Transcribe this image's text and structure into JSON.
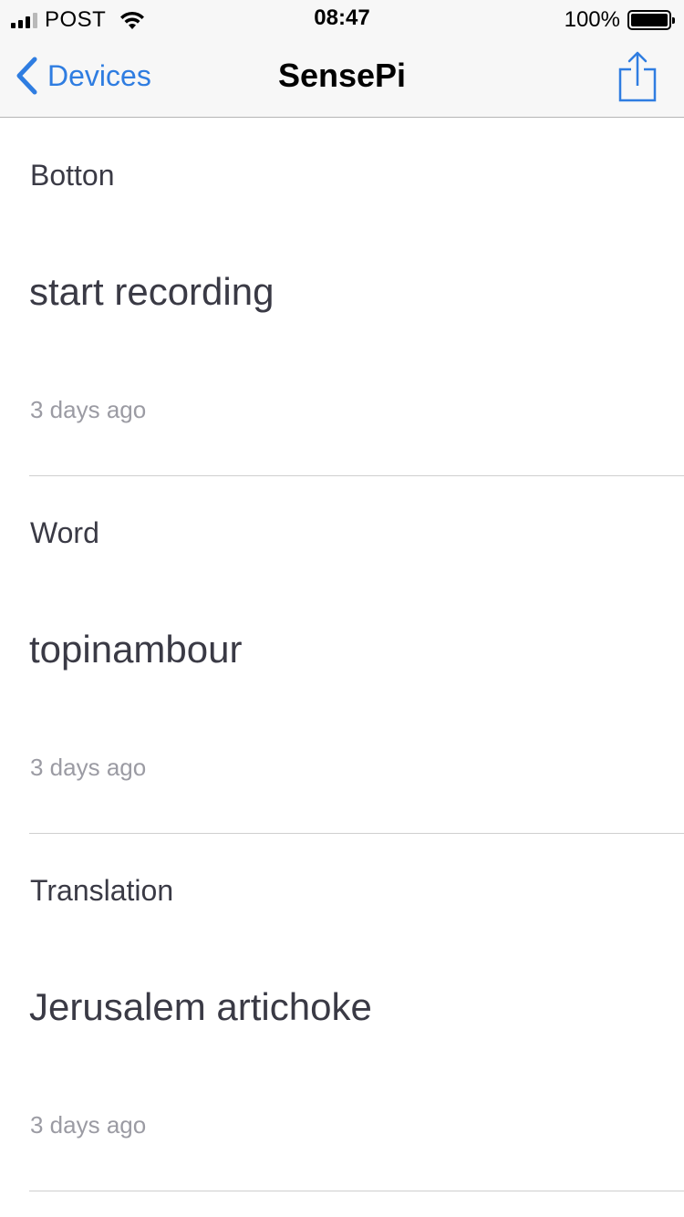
{
  "status_bar": {
    "carrier": "POST",
    "time": "08:47",
    "battery": "100%"
  },
  "nav": {
    "back_label": "Devices",
    "title": "SensePi",
    "accent_color": "#2f7de1"
  },
  "items": [
    {
      "label": "Botton",
      "value": "start recording",
      "time": "3 days ago"
    },
    {
      "label": "Word",
      "value": "topinambour",
      "time": "3 days ago"
    },
    {
      "label": "Translation",
      "value": "Jerusalem artichoke",
      "time": "3 days ago"
    }
  ]
}
